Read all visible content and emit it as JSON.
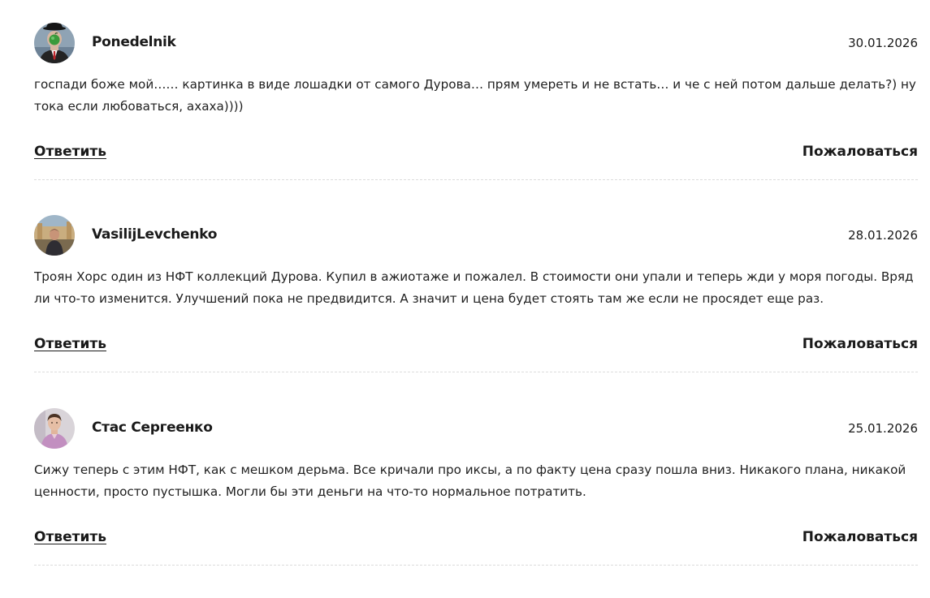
{
  "comments": [
    {
      "author": "Ponedelnik",
      "date": "30.01.2026",
      "text": "госпади боже мой…… картинка в виде лошадки от самого Дурова… прям умереть и не встать… и че с ней потом дальше делать?) ну тока если любоваться, ахаха))))",
      "reply_label": "Ответить",
      "report_label": "Пожаловаться",
      "avatar_icon": "man-in-bowler-hat-avatar"
    },
    {
      "author": "VasilijLevchenko",
      "date": "28.01.2026",
      "text": "Троян Хорс один из НФТ коллекций Дурова. Купил в ажиотаже и пожалел. В стоимости они упали и теперь жди у моря погоды. Вряд ли что-то изменится. Улучшений пока не предвидится. А значит и цена будет стоять там же если не просядет еще раз.",
      "reply_label": "Ответить",
      "report_label": "Пожаловаться",
      "avatar_icon": "man-outdoors-avatar"
    },
    {
      "author": "Стас Сергеенко",
      "date": "25.01.2026",
      "text": "Сижу теперь с этим НФТ, как с мешком дерьма. Все кричали про иксы, а по факту цена сразу пошла вниз. Никакого плана, никакой ценности, просто пустышка. Могли бы эти деньги на что-то нормальное потратить.",
      "reply_label": "Ответить",
      "report_label": "Пожаловаться",
      "avatar_icon": "man-portrait-avatar"
    }
  ]
}
